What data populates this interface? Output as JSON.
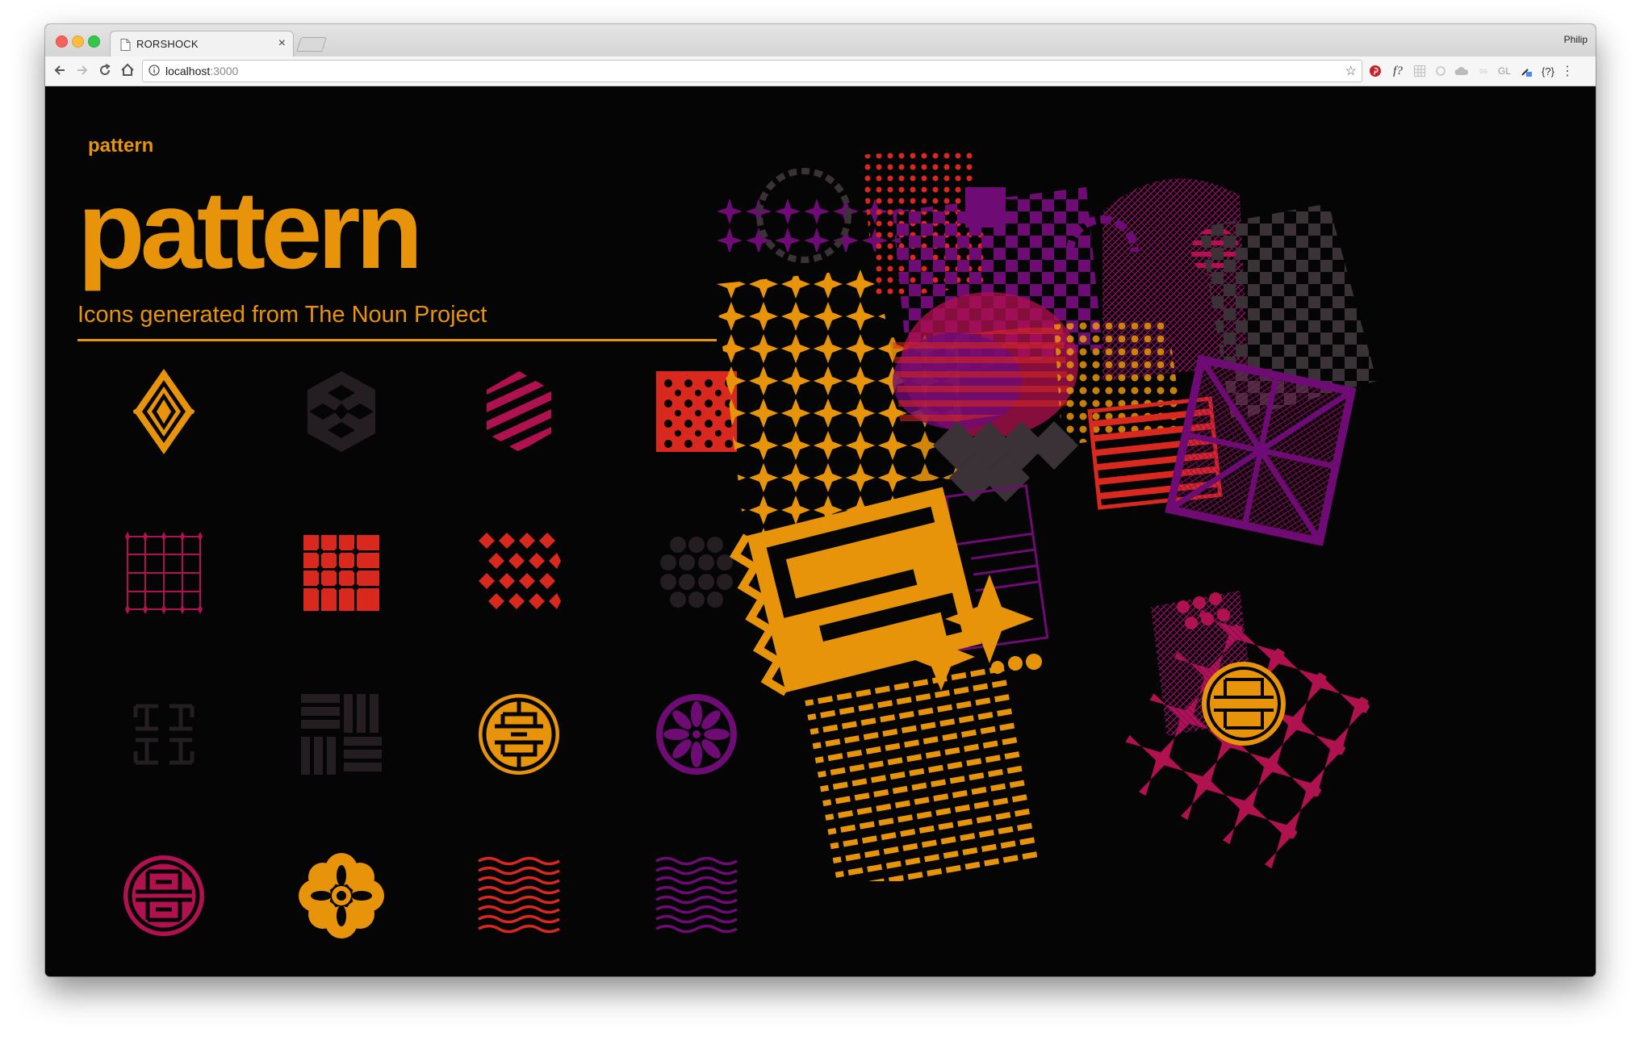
{
  "browser": {
    "tab_title": "RORSHOCK",
    "profile_name": "Philip",
    "url_host": "localhost",
    "url_port": ":3000",
    "extensions": [
      "pinterest-icon",
      "f?",
      "grid-icon",
      "sync-icon",
      "cloud-icon",
      "ss",
      "GL",
      "eyedropper-icon",
      "{?}",
      "menu-icon"
    ]
  },
  "page": {
    "small_title": "pattern",
    "title": "pattern",
    "subtitle": "Icons generated from The Noun Project",
    "accent_color": "#e8940b",
    "background_color": "#050505"
  },
  "icons": [
    {
      "name": "diamond-pattern-icon",
      "color": "#e8940b"
    },
    {
      "name": "hexagon-cube-pattern-icon",
      "color": "#241d22"
    },
    {
      "name": "striped-hexagon-icon",
      "color": "#b0124f"
    },
    {
      "name": "x-grid-pattern-icon",
      "color": "#d9281e"
    },
    {
      "name": "plus-grid-pattern-icon",
      "color": "#b0124f"
    },
    {
      "name": "cross-tile-pattern-icon",
      "color": "#d9281e"
    },
    {
      "name": "diamond-grid-pattern-icon",
      "color": "#d9281e"
    },
    {
      "name": "circle-cluster-pattern-icon",
      "color": "#241d22"
    },
    {
      "name": "bracket-maze-icon",
      "color": "#241d22"
    },
    {
      "name": "basket-weave-icon",
      "color": "#241d22"
    },
    {
      "name": "chinese-medallion-icon",
      "color": "#e8940b"
    },
    {
      "name": "flower-rosette-icon",
      "color": "#6e0b75"
    },
    {
      "name": "shou-medallion-icon",
      "color": "#b0124f"
    },
    {
      "name": "flower-icon",
      "color": "#e8940b"
    },
    {
      "name": "red-wave-lines-icon",
      "color": "#d9281e"
    },
    {
      "name": "purple-wave-lines-icon",
      "color": "#6e0b75"
    }
  ]
}
